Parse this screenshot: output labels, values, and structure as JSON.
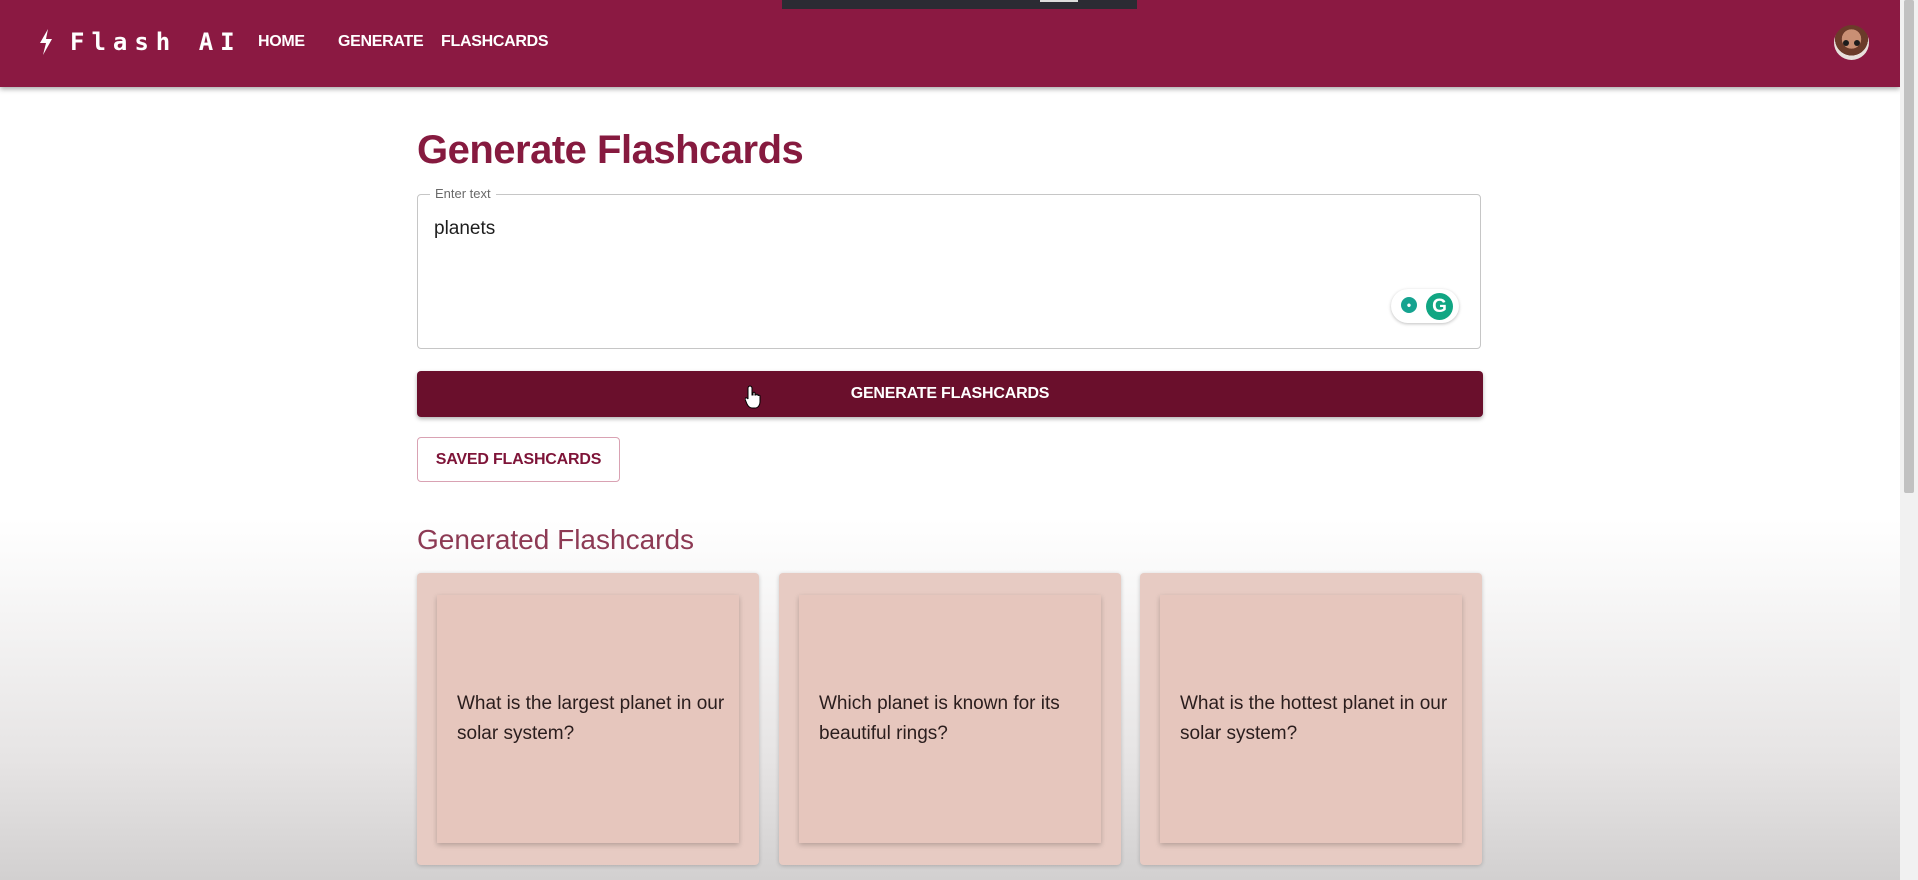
{
  "app": {
    "brand": "Flash AI",
    "nav": [
      {
        "label": "HOME"
      },
      {
        "label": "GENERATE"
      },
      {
        "label": "FLASHCARDS"
      }
    ],
    "colors": {
      "appbar": "#8b1942",
      "primary_button": "#6a0f2c",
      "title": "#861a3f",
      "card": "#e7cbc3"
    }
  },
  "main": {
    "title": "Generate Flashcards",
    "input": {
      "label": "Enter text",
      "value": "planets"
    },
    "generate_button": "GENERATE FLASHCARDS",
    "saved_button": "SAVED FLASHCARDS",
    "generated_title": "Generated Flashcards",
    "cards": [
      {
        "question": "What is the largest planet in our solar system?"
      },
      {
        "question": "Which planet is known for its beautiful rings?"
      },
      {
        "question": "What is the hottest planet in our solar system?"
      }
    ]
  },
  "icons": [
    "bolt-icon",
    "avatar",
    "grammarly-suggestion-icon",
    "grammarly-logo-icon",
    "hand-cursor-icon"
  ]
}
